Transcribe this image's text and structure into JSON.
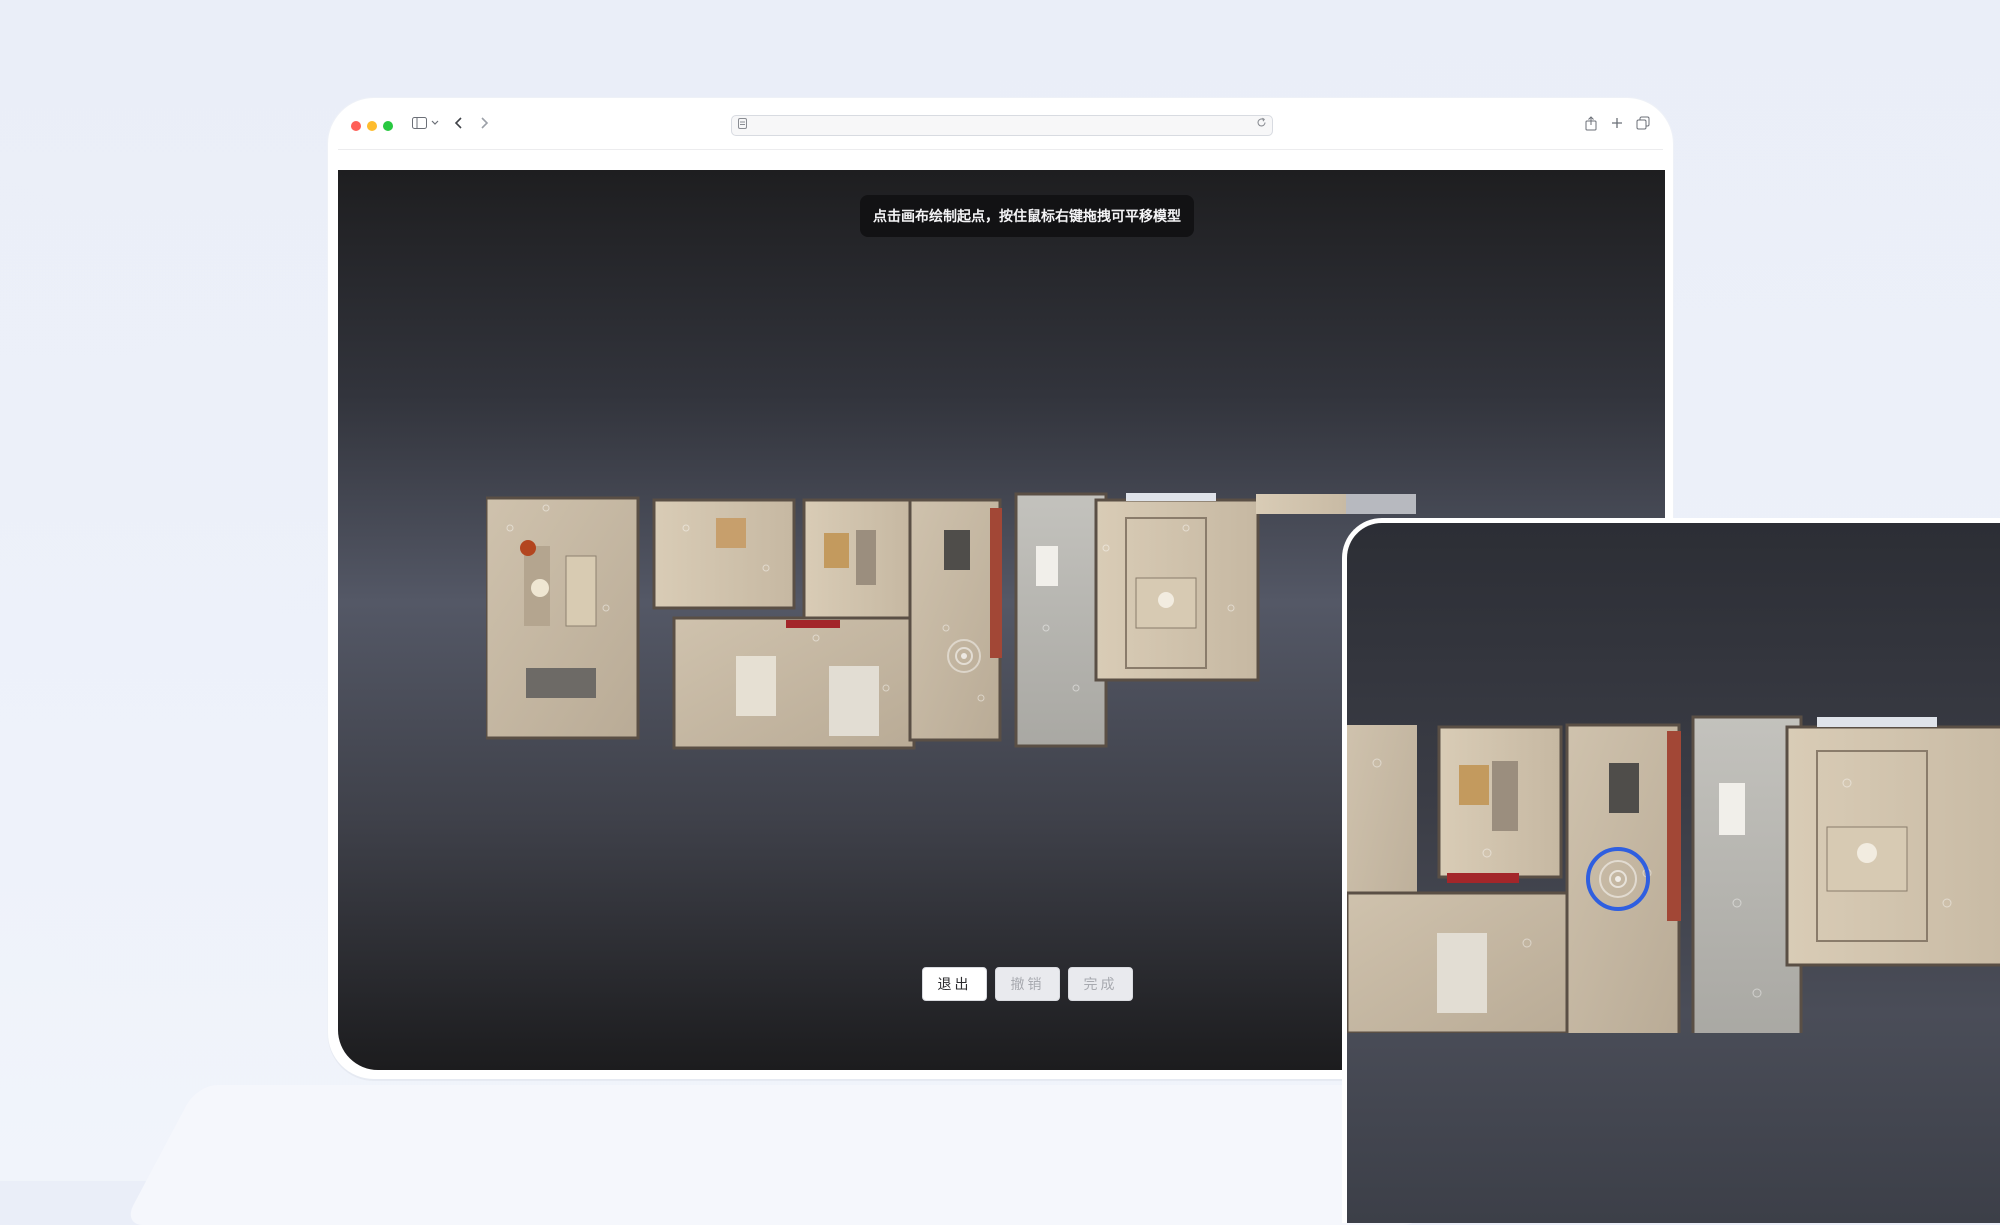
{
  "browser": {
    "url_text": "",
    "toolbar_icons": [
      "sidebar-icon",
      "chevron-down-icon",
      "back-icon",
      "forward-icon",
      "share-icon",
      "new-tab-icon",
      "tabs-overview-icon"
    ]
  },
  "canvas": {
    "hint": "点击画布绘制起点，按住鼠标右键拖拽可平移模型"
  },
  "actions": {
    "exit": "退出",
    "undo": "撤销",
    "done": "完成"
  },
  "colors": {
    "accent_ring": "#2f5fe0",
    "traffic_red": "#fe5f57",
    "traffic_yellow": "#febc2e",
    "traffic_green": "#28c840"
  }
}
